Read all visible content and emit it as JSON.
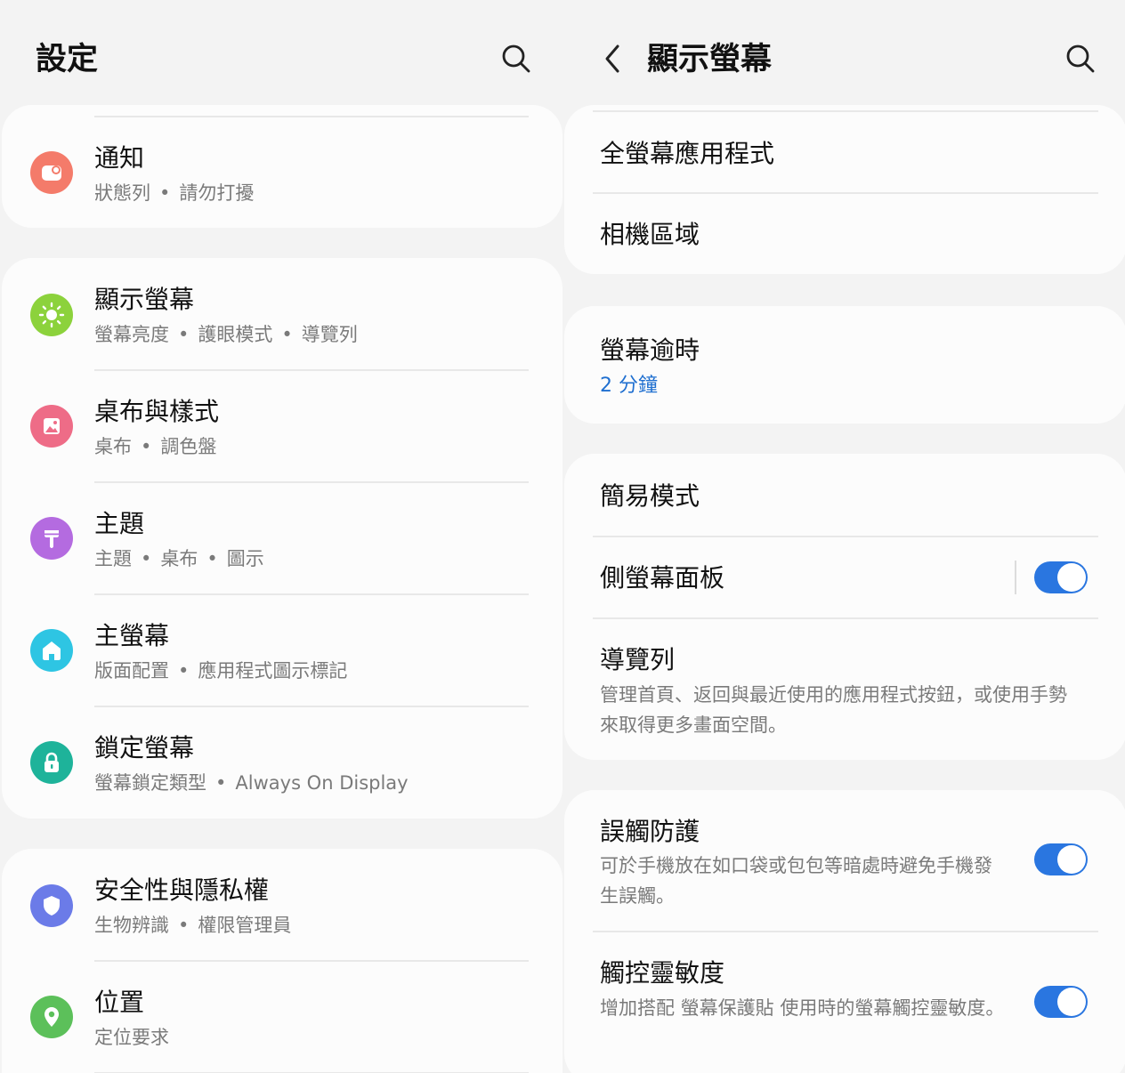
{
  "left": {
    "title": "設定",
    "groups": [
      {
        "items": [
          {
            "title": "通知",
            "subtitle": [
              "狀態列",
              "請勿打擾"
            ],
            "icon": "notification-icon",
            "color": "#f47b6a"
          }
        ]
      },
      {
        "items": [
          {
            "title": "顯示螢幕",
            "subtitle": [
              "螢幕亮度",
              "護眼模式",
              "導覽列"
            ],
            "icon": "brightness-icon",
            "color": "#8cd23c"
          },
          {
            "title": "桌布與樣式",
            "subtitle": [
              "桌布",
              "調色盤"
            ],
            "icon": "wallpaper-icon",
            "color": "#ee6c87"
          },
          {
            "title": "主題",
            "subtitle": [
              "主題",
              "桌布",
              "圖示"
            ],
            "icon": "theme-icon",
            "color": "#b46be0"
          },
          {
            "title": "主螢幕",
            "subtitle": [
              "版面配置",
              "應用程式圖示標記"
            ],
            "icon": "home-icon",
            "color": "#2ec5e3"
          },
          {
            "title": "鎖定螢幕",
            "subtitle": [
              "螢幕鎖定類型",
              "Always On Display"
            ],
            "icon": "lock-icon",
            "color": "#1eb39a"
          }
        ]
      },
      {
        "items": [
          {
            "title": "安全性與隱私權",
            "subtitle": [
              "生物辨識",
              "權限管理員"
            ],
            "icon": "shield-icon",
            "color": "#6b7be8"
          },
          {
            "title": "位置",
            "subtitle": [
              "定位要求"
            ],
            "icon": "location-pin-icon",
            "color": "#5cc05a"
          }
        ]
      }
    ]
  },
  "right": {
    "title": "顯示螢幕",
    "items": {
      "fullscreen_apps": {
        "title": "全螢幕應用程式"
      },
      "camera_cutout": {
        "title": "相機區域"
      },
      "screen_timeout": {
        "title": "螢幕逾時",
        "value": "2 分鐘"
      },
      "easy_mode": {
        "title": "簡易模式"
      },
      "edge_panels": {
        "title": "側螢幕面板",
        "toggle": true
      },
      "navigation_bar": {
        "title": "導覽列",
        "description": "管理首頁、返回與最近使用的應用程式按鈕，或使用手勢來取得更多畫面空間。"
      },
      "accidental_touch": {
        "title": "誤觸防護",
        "description": "可於手機放在如口袋或包包等暗處時避免手機發生誤觸。",
        "toggle": true
      },
      "touch_sensitivity": {
        "title": "觸控靈敏度",
        "description": "增加搭配 螢幕保護貼 使用時的螢幕觸控靈敏度。",
        "toggle": true
      }
    }
  },
  "colors": {
    "accent": "#2a76e0",
    "value_blue": "#1f6fd0"
  }
}
